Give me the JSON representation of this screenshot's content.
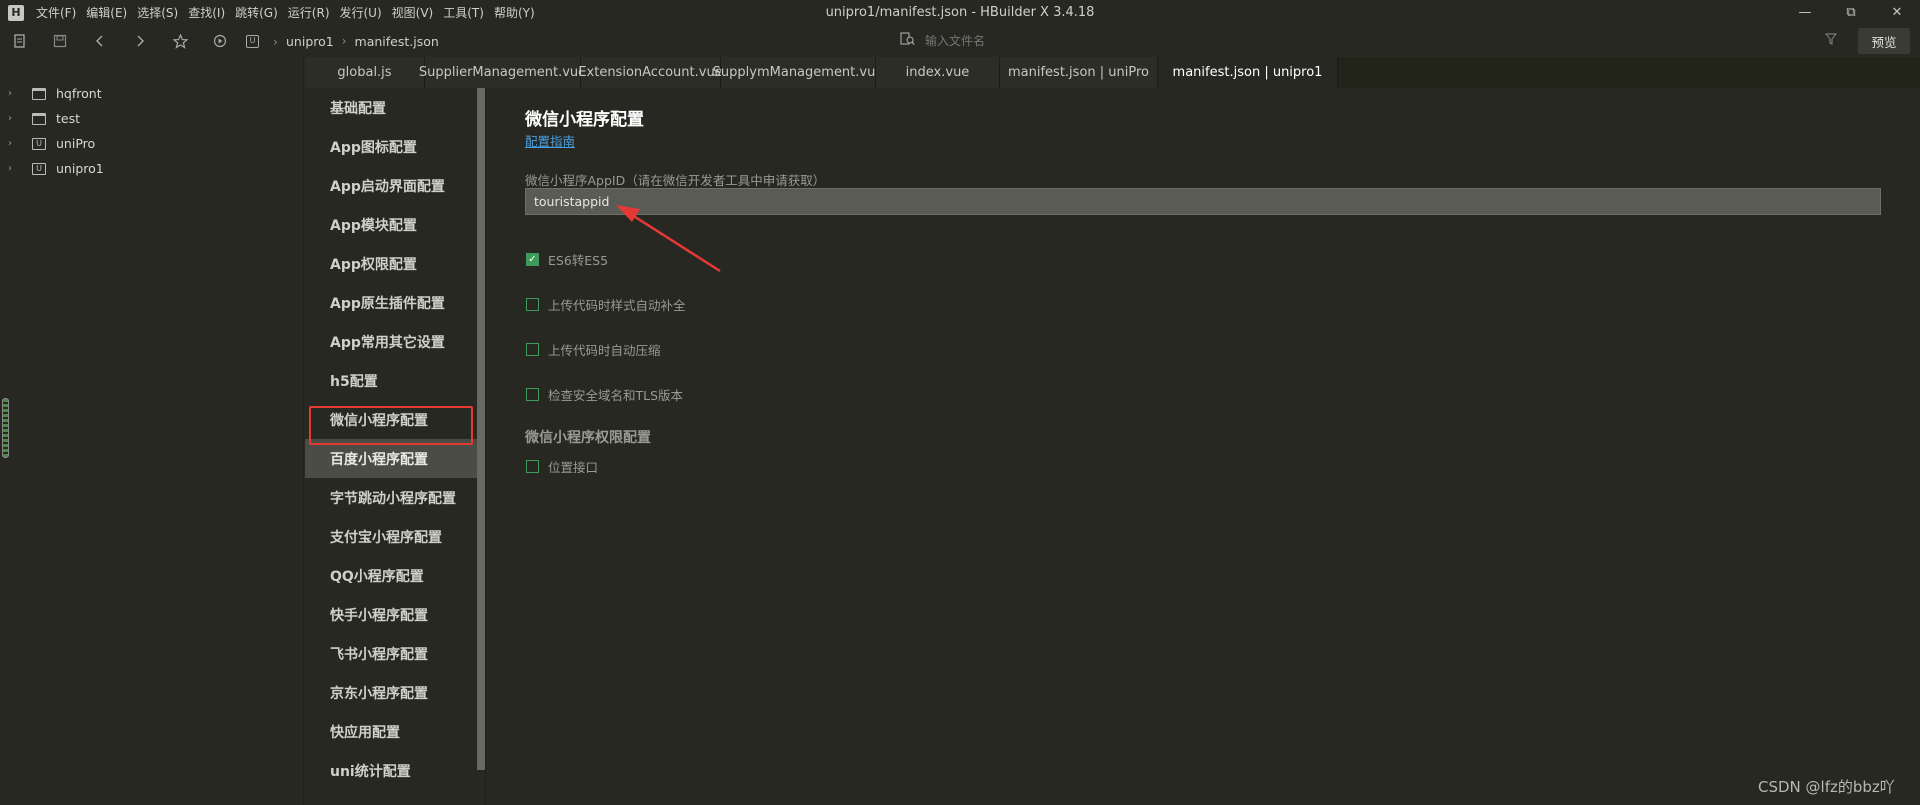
{
  "app": {
    "logo_letter": "H",
    "window_title": "unipro1/manifest.json - HBuilder X 3.4.18",
    "menus": [
      "文件(F)",
      "编辑(E)",
      "选择(S)",
      "查找(I)",
      "跳转(G)",
      "运行(R)",
      "发行(U)",
      "视图(V)",
      "工具(T)",
      "帮助(Y)"
    ],
    "win_controls": {
      "minimize": "—",
      "restore": "⧉",
      "close": "✕"
    }
  },
  "toolbar": {
    "breadcrumb": [
      "unipro1",
      "manifest.json"
    ],
    "breadcrumb_sep": "›",
    "search_placeholder": "输入文件名",
    "preview_label": "预览"
  },
  "tree": {
    "items": [
      {
        "label": "hqfront",
        "type": "folder"
      },
      {
        "label": "test",
        "type": "folder"
      },
      {
        "label": "uniPro",
        "type": "project"
      },
      {
        "label": "unipro1",
        "type": "project"
      }
    ]
  },
  "tabs": [
    {
      "label": "global.js",
      "width": 120
    },
    {
      "label": "SupplierManagement.vue",
      "width": 156
    },
    {
      "label": "ExtensionAccount.vue",
      "width": 140
    },
    {
      "label": "SupplymManagement.vue",
      "width": 155
    },
    {
      "label": "index.vue",
      "width": 124
    },
    {
      "label": "manifest.json | uniPro",
      "width": 158
    },
    {
      "label": "manifest.json | unipro1",
      "width": 180
    }
  ],
  "active_tab": 6,
  "nav": {
    "items": [
      "基础配置",
      "App图标配置",
      "App启动界面配置",
      "App模块配置",
      "App权限配置",
      "App原生插件配置",
      "App常用其它设置",
      "h5配置",
      "微信小程序配置",
      "百度小程序配置",
      "字节跳动小程序配置",
      "支付宝小程序配置",
      "QQ小程序配置",
      "快手小程序配置",
      "飞书小程序配置",
      "京东小程序配置",
      "快应用配置",
      "uni统计配置"
    ],
    "selected_index": 9
  },
  "content": {
    "title": "微信小程序配置",
    "guide_link": "配置指南",
    "appid_label": "微信小程序AppID（请在微信开发者工具中申请获取）",
    "appid_value": "touristappid",
    "options": [
      {
        "label": "ES6转ES5",
        "checked": true
      },
      {
        "label": "上传代码时样式自动补全",
        "checked": false
      },
      {
        "label": "上传代码时自动压缩",
        "checked": false
      },
      {
        "label": "检查安全域名和TLS版本",
        "checked": false
      }
    ],
    "perm_title": "微信小程序权限配置",
    "perm_options": [
      {
        "label": "位置接口",
        "checked": false
      }
    ]
  },
  "annotation_color": "#e53935",
  "watermark": "CSDN @lfz的bbz吖"
}
